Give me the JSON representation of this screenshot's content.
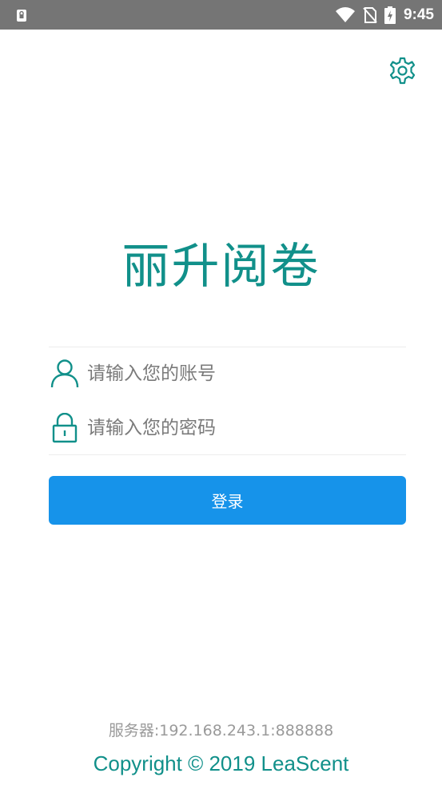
{
  "status_bar": {
    "time": "9:45",
    "icons": [
      "lock-notification-icon",
      "wifi-icon",
      "no-sim-icon",
      "battery-charging-icon"
    ]
  },
  "header": {
    "settings_icon": "gear-icon"
  },
  "app": {
    "title": "丽升阅卷",
    "accent_color": "#11908a"
  },
  "form": {
    "account": {
      "icon": "user-icon",
      "placeholder": "请输入您的账号",
      "value": ""
    },
    "password": {
      "icon": "lock-icon",
      "placeholder": "请输入您的密码",
      "value": ""
    },
    "login_label": "登录",
    "login_color": "#1693ea"
  },
  "footer": {
    "server": "服务器:192.168.243.1:888888",
    "copyright": "Copyright © 2019 LeaScent"
  }
}
